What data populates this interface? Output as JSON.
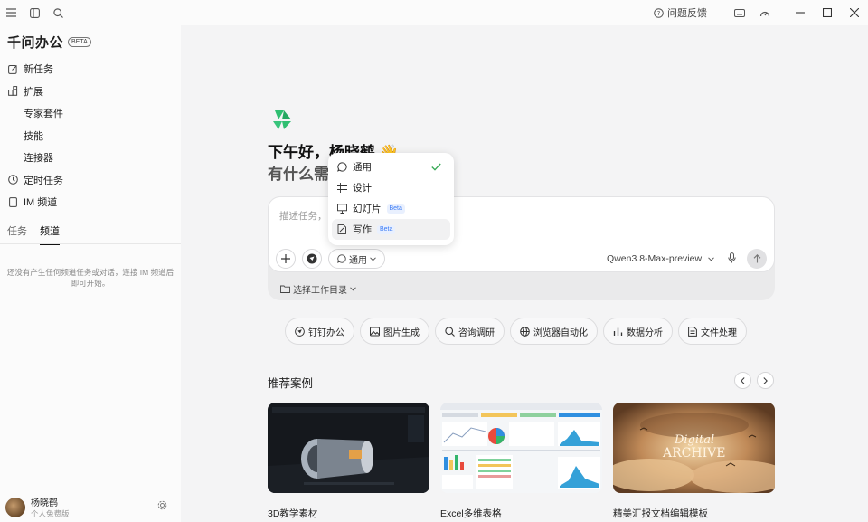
{
  "titlebar": {
    "icons": [
      "menu-icon",
      "sidebar-toggle-icon",
      "search-icon"
    ],
    "feedback_label": "问题反馈",
    "window_buttons": [
      "minimize",
      "maximize",
      "close"
    ]
  },
  "sidebar": {
    "brand": "千问办公",
    "brand_badge": "BETA",
    "items": [
      {
        "label": "新任务",
        "icon": "edit-icon"
      },
      {
        "label": "扩展",
        "icon": "extension-icon"
      },
      {
        "label": "专家套件",
        "sub": true
      },
      {
        "label": "技能",
        "sub": true
      },
      {
        "label": "连接器",
        "sub": true
      },
      {
        "label": "定时任务",
        "icon": "clock-icon"
      },
      {
        "label": "IM 频道",
        "icon": "phone-icon"
      }
    ],
    "tabs": [
      "任务",
      "频道"
    ],
    "active_tab": "频道",
    "empty_text": "还没有产生任何频道任务或对话，连接 IM 频道后即可开始。",
    "user_name": "杨晓鹤",
    "user_plan": "个人免费版"
  },
  "main": {
    "greeting": "下午好，杨晓鹤 👋",
    "subtitle": "有什么需",
    "composer": {
      "placeholder": "描述任务，",
      "mode_label": "通用",
      "model_label": "Qwen3.8-Max-preview",
      "workdir_label": "选择工作目录"
    },
    "dropdown": [
      {
        "label": "通用",
        "icon": "chat-icon",
        "checked": true
      },
      {
        "label": "设计",
        "icon": "grid-icon"
      },
      {
        "label": "幻灯片",
        "icon": "presentation-icon",
        "badge": "Beta"
      },
      {
        "label": "写作",
        "icon": "pen-doc-icon",
        "badge": "Beta",
        "hover": true
      }
    ],
    "chips": [
      {
        "label": "钉钉办公",
        "icon": "dingtalk-icon"
      },
      {
        "label": "图片生成",
        "icon": "image-icon"
      },
      {
        "label": "咨询调研",
        "icon": "search-icon"
      },
      {
        "label": "浏览器自动化",
        "icon": "globe-icon"
      },
      {
        "label": "数据分析",
        "icon": "bar-chart-icon"
      },
      {
        "label": "文件处理",
        "icon": "document-icon"
      }
    ],
    "recommend_title": "推荐案例",
    "cards": [
      {
        "label": "3D教学素材"
      },
      {
        "label": "Excel多维表格"
      },
      {
        "label": "精美汇报文档编辑模板",
        "art_text_1": "Digital",
        "art_text_2": "ARCHIVE"
      }
    ]
  },
  "colors": {
    "accent_green": "#2fbf71",
    "beta_blue": "#3b7bf5",
    "check_green": "#34a853"
  }
}
